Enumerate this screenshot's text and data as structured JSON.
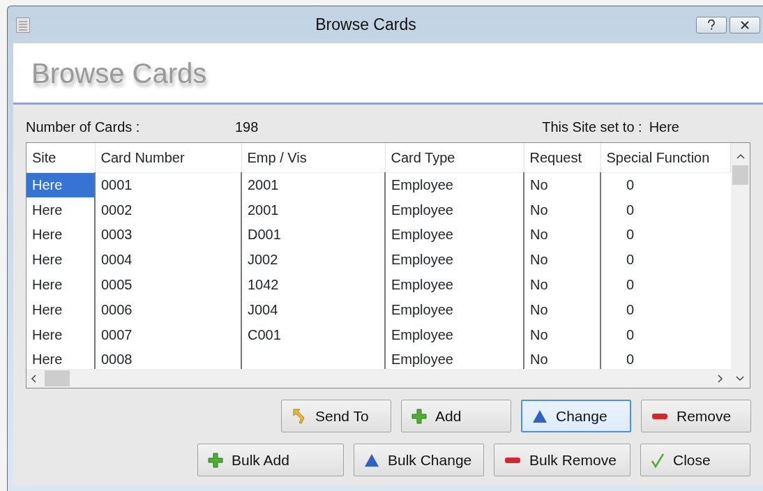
{
  "window": {
    "title": "Browse Cards"
  },
  "header": {
    "title": "Browse Cards"
  },
  "info": {
    "count_label": "Number of Cards :",
    "count": "198",
    "site_label": "This Site set to :",
    "site": "Here"
  },
  "table": {
    "columns": [
      "Site",
      "Card Number",
      "Emp / Vis",
      "Card Type",
      "Request",
      "Special Function"
    ],
    "rows": [
      {
        "site": "Here",
        "card_number": "0001",
        "emp_vis": "2001",
        "card_type": "Employee",
        "request": "No",
        "special_function": "0",
        "selected": true
      },
      {
        "site": "Here",
        "card_number": "0002",
        "emp_vis": "2001",
        "card_type": "Employee",
        "request": "No",
        "special_function": "0",
        "selected": false
      },
      {
        "site": "Here",
        "card_number": "0003",
        "emp_vis": "D001",
        "card_type": "Employee",
        "request": "No",
        "special_function": "0",
        "selected": false
      },
      {
        "site": "Here",
        "card_number": "0004",
        "emp_vis": "J002",
        "card_type": "Employee",
        "request": "No",
        "special_function": "0",
        "selected": false
      },
      {
        "site": "Here",
        "card_number": "0005",
        "emp_vis": "1042",
        "card_type": "Employee",
        "request": "No",
        "special_function": "0",
        "selected": false
      },
      {
        "site": "Here",
        "card_number": "0006",
        "emp_vis": "J004",
        "card_type": "Employee",
        "request": "No",
        "special_function": "0",
        "selected": false
      },
      {
        "site": "Here",
        "card_number": "0007",
        "emp_vis": "C001",
        "card_type": "Employee",
        "request": "No",
        "special_function": "0",
        "selected": false
      },
      {
        "site": "Here",
        "card_number": "0008",
        "card_type": "Employee",
        "request": "No",
        "special_function": "0",
        "selected": false
      }
    ]
  },
  "button_rows": [
    [
      {
        "label": "Send To",
        "kind": "send",
        "focused": false
      },
      {
        "label": "Add",
        "kind": "add",
        "focused": false
      },
      {
        "label": "Change",
        "kind": "change",
        "focused": true
      },
      {
        "label": "Remove",
        "kind": "remove",
        "focused": false
      }
    ],
    [
      {
        "label": "Bulk Add",
        "kind": "add",
        "focused": false
      },
      {
        "label": "Bulk Change",
        "kind": "change",
        "focused": false
      },
      {
        "label": "Bulk Remove",
        "kind": "remove",
        "focused": false
      },
      {
        "label": "Close",
        "kind": "close",
        "focused": false
      }
    ]
  ]
}
